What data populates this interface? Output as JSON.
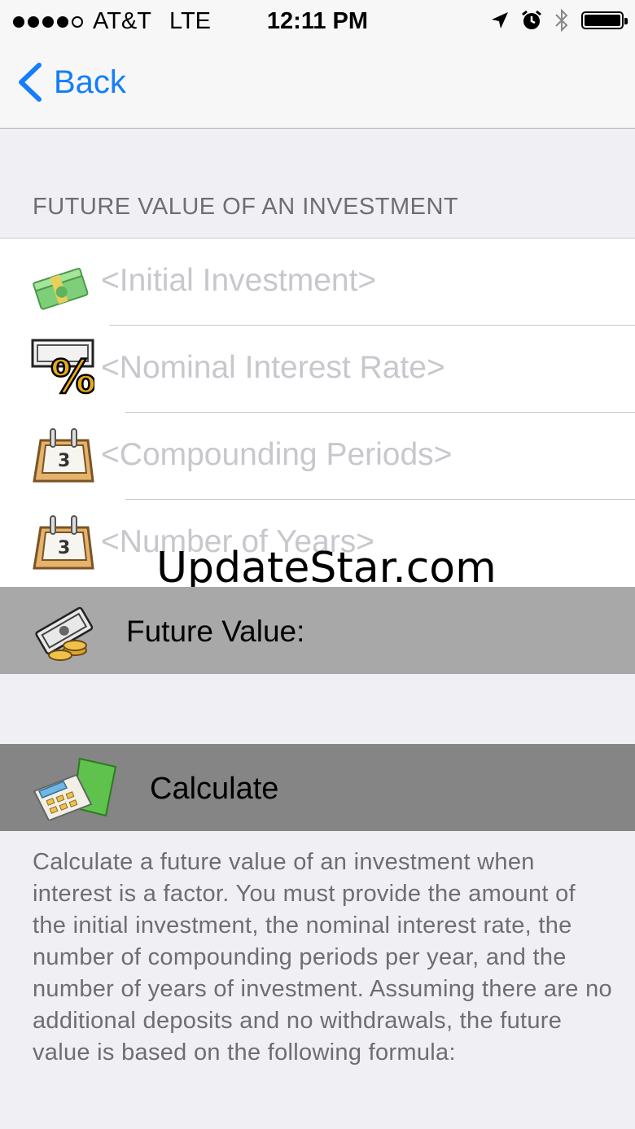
{
  "status_bar": {
    "carrier": "AT&T",
    "network": "LTE",
    "time": "12:11 PM"
  },
  "nav": {
    "back_label": "Back"
  },
  "section_header": "FUTURE VALUE OF AN INVESTMENT",
  "fields": [
    {
      "placeholder": "<Initial Investment>",
      "icon": "money-stack-icon"
    },
    {
      "placeholder": "<Nominal Interest Rate>",
      "icon": "percent-icon"
    },
    {
      "placeholder": "<Compounding Periods>",
      "icon": "calendar-icon"
    },
    {
      "placeholder": "<Number of Years>",
      "icon": "calendar-icon"
    }
  ],
  "result": {
    "label": "Future Value:",
    "icon": "money-coins-icon"
  },
  "calculate": {
    "label": "Calculate",
    "icon": "calculator-folder-icon"
  },
  "description": "Calculate a future value of an investment when interest is a factor.  You must provide the amount of the initial investment, the nominal interest rate, the number of compounding periods per year, and the number of years of investment.  Assuming there are no additional deposits and no withdrawals, the future value is based on the following formula:",
  "watermark": "UpdateStar.com",
  "colors": {
    "accent": "#147efb",
    "result_bar": "#a8a8a8",
    "calculate_bar": "#858585",
    "placeholder": "#c7c7cd"
  }
}
